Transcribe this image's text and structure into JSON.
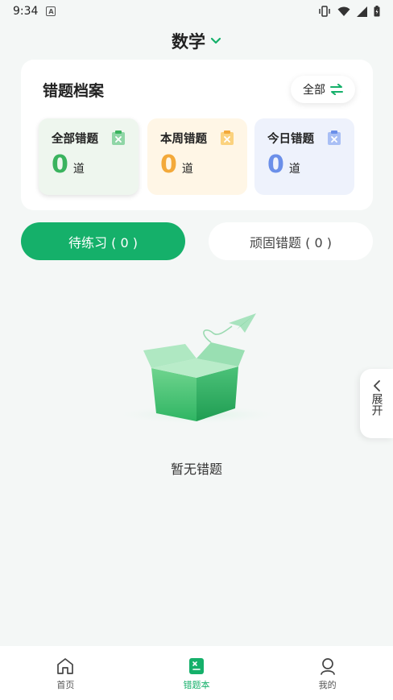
{
  "status_bar": {
    "time": "9:34",
    "notification_letter": "A"
  },
  "header": {
    "subject": "数学"
  },
  "archive": {
    "title": "错题档案",
    "filter_label": "全部",
    "stats": [
      {
        "label": "全部错题",
        "count": "0",
        "unit": "道",
        "color": "#3ab35e"
      },
      {
        "label": "本周错题",
        "count": "0",
        "unit": "道",
        "color": "#f3a93a"
      },
      {
        "label": "今日错题",
        "count": "0",
        "unit": "道",
        "color": "#6b8fe9"
      }
    ]
  },
  "tabs": {
    "pending": "待练习 ( 0 )",
    "consolidate": "顽固错题 ( 0 )"
  },
  "empty_state": {
    "text": "暂无错题"
  },
  "side_panel": {
    "label": "展开"
  },
  "bottom_nav": [
    {
      "label": "首页",
      "icon": "home-icon"
    },
    {
      "label": "错题本",
      "icon": "notebook-icon"
    },
    {
      "label": "我的",
      "icon": "profile-icon"
    }
  ],
  "colors": {
    "accent": "#15b06a",
    "background": "#f4f7f6"
  }
}
